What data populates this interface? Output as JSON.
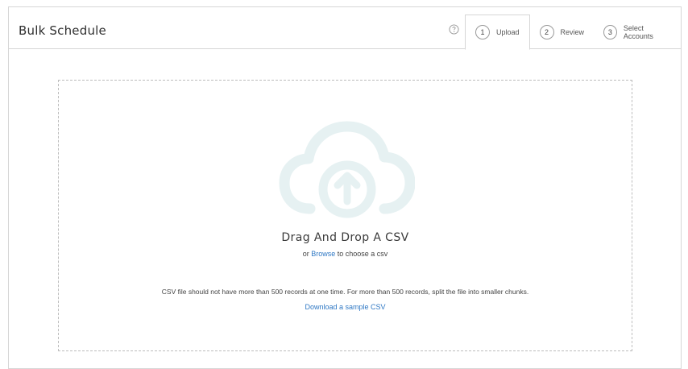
{
  "header": {
    "title": "Bulk Schedule",
    "help_icon": "question-circle-icon",
    "steps": [
      {
        "num": "1",
        "label": "Upload",
        "active": true
      },
      {
        "num": "2",
        "label": "Review",
        "active": false
      },
      {
        "num": "3",
        "label": "Select Accounts",
        "active": false
      }
    ]
  },
  "dropzone": {
    "icon": "cloud-upload-icon",
    "icon_color": "#e6f1f2",
    "title": "Drag And Drop A CSV",
    "browse_prefix": "or",
    "browse_link": "Browse",
    "browse_suffix": "to choose a csv",
    "note": "CSV file should not have more than 500 records at one time. For more than 500 records, split the file into smaller chunks.",
    "sample_link": "Download a sample CSV"
  },
  "colors": {
    "link": "#2f78c4",
    "border": "#d6d6d6"
  }
}
